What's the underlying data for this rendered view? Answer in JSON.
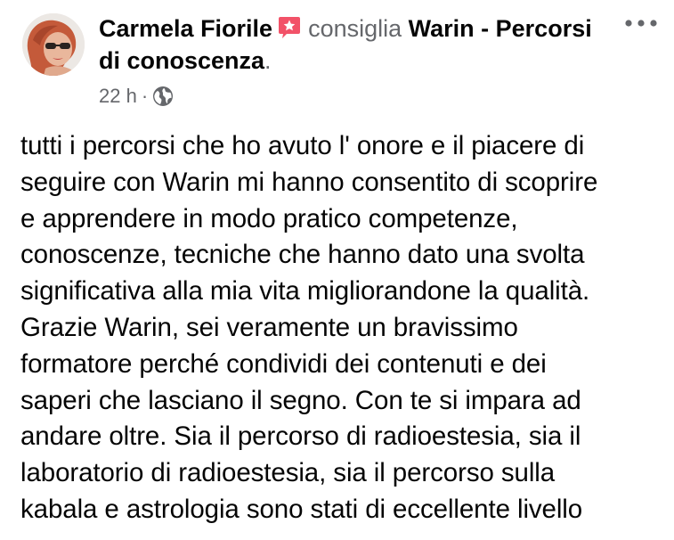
{
  "post": {
    "author": "Carmela Fiorile",
    "action": "consiglia",
    "page_name": "Warin - Percorsi di conoscenza",
    "page_suffix": ".",
    "time": "22 h",
    "separator": "·",
    "privacy_icon": "globe-icon",
    "badge_icon": "recommend-star-badge-icon",
    "more_icon": "more-dots-icon",
    "body": "tutti i percorsi che ho avuto l' onore e il piacere di\nseguire con Warin mi hanno consentito di scoprire\ne apprendere in modo pratico competenze,\nconoscenze, tecniche che hanno dato una svolta\nsignificativa alla mia vita migliorandone la qualità.\nGrazie Warin, sei veramente un bravissimo\nformatore perché condividi dei contenuti e dei\nsaperi che lasciano il segno. Con te si impara ad\nandare oltre. Sia il percorso di radioestesia, sia il\nlaboratorio di radioestesia, sia il percorso sulla\nkabala e astrologia sono stati di eccellente livello"
  },
  "colors": {
    "primary_text": "#050505",
    "secondary_text": "#65676b",
    "badge": "#f25268",
    "icon_gray": "#65676b"
  }
}
